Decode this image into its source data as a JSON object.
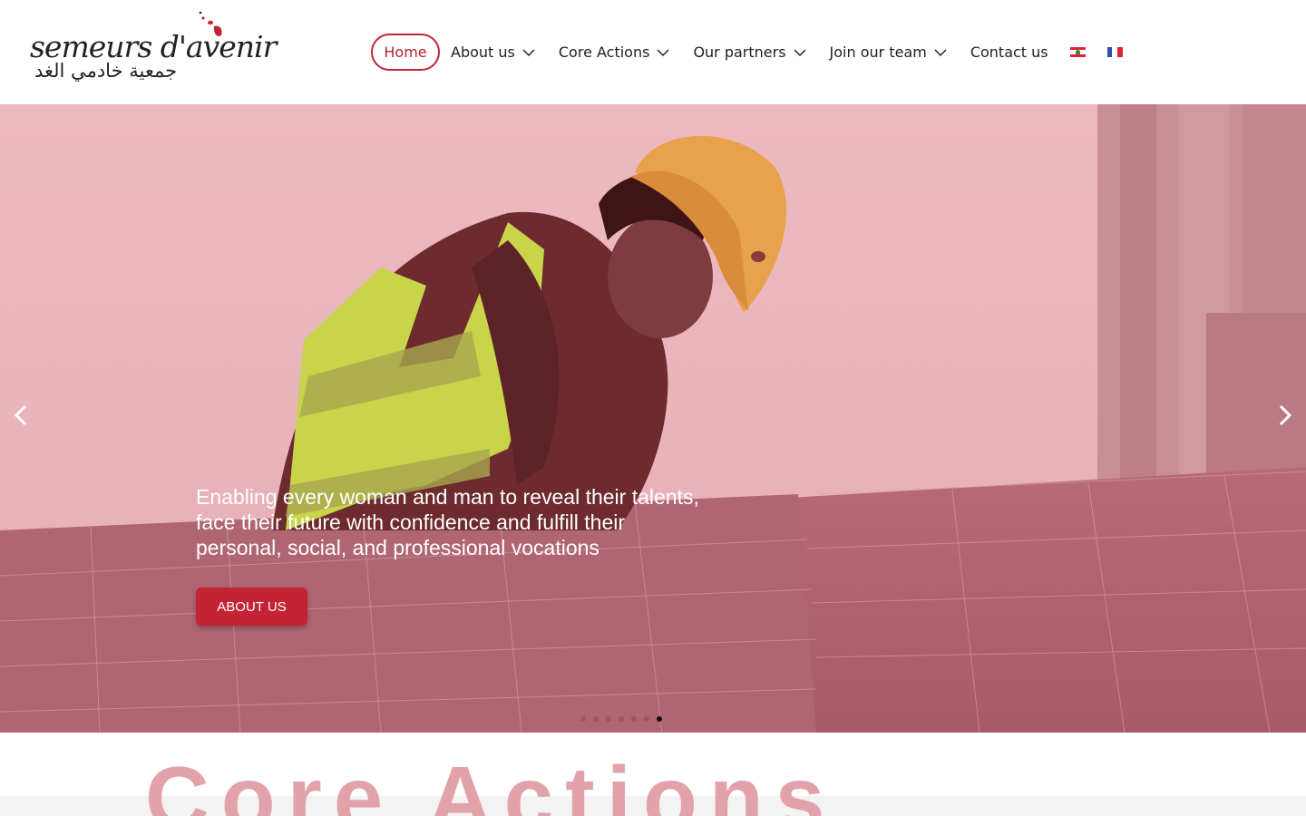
{
  "header": {
    "logo_text": "semeurs d'avenir",
    "logo_arabic": "جمعية خادمي الغد",
    "brand_color": "#c0263a"
  },
  "nav": {
    "items": [
      {
        "label": "Home",
        "active": true,
        "dropdown": false
      },
      {
        "label": "About us",
        "dropdown": true
      },
      {
        "label": "Core Actions",
        "dropdown": true
      },
      {
        "label": "Our partners",
        "dropdown": true
      },
      {
        "label": "Join our team",
        "dropdown": true
      },
      {
        "label": "Contact us",
        "dropdown": false
      }
    ],
    "languages": [
      {
        "icon": "lebanon-flag-icon"
      },
      {
        "icon": "france-flag-icon"
      }
    ]
  },
  "hero": {
    "tagline": "Enabling every woman and man to reveal their talents, face their future with confidence and fulfill their personal, social, and professional vocations",
    "button_label": "ABOUT US",
    "button_color": "#c42336",
    "overlay_color": "#e9b8bf",
    "slide_count": 7,
    "active_slide": 7
  },
  "section": {
    "title": "Core Actions",
    "title_color": "#e2a2a9"
  }
}
